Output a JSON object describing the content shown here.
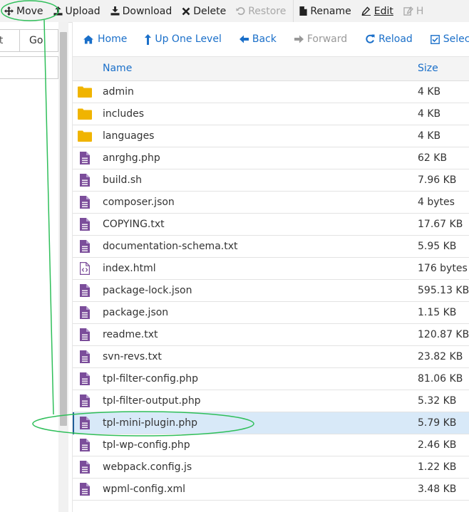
{
  "toolbar": {
    "items": [
      {
        "label": "Move",
        "icon": "move-icon"
      },
      {
        "label": "Upload",
        "icon": "upload-icon"
      },
      {
        "label": "Download",
        "icon": "download-icon"
      },
      {
        "label": "Delete",
        "icon": "delete-icon"
      },
      {
        "label": "Restore",
        "icon": "restore-icon",
        "disabled": true
      },
      {
        "label": "Rename",
        "icon": "rename-icon"
      },
      {
        "label": "Edit",
        "icon": "edit-icon"
      },
      {
        "label": "H",
        "icon": "html-editor-icon",
        "disabled": true
      }
    ]
  },
  "left": {
    "input_value": "nt",
    "go_label": "Go"
  },
  "nav": {
    "home": "Home",
    "up": "Up One Level",
    "back": "Back",
    "forward": "Forward",
    "reload": "Reload",
    "select_all": "Select All"
  },
  "table": {
    "col_name": "Name",
    "col_size": "Size",
    "rows": [
      {
        "name": "admin",
        "size": "4 KB",
        "type": "folder"
      },
      {
        "name": "includes",
        "size": "4 KB",
        "type": "folder"
      },
      {
        "name": "languages",
        "size": "4 KB",
        "type": "folder"
      },
      {
        "name": "anrghg.php",
        "size": "62 KB",
        "type": "file"
      },
      {
        "name": "build.sh",
        "size": "7.96 KB",
        "type": "file"
      },
      {
        "name": "composer.json",
        "size": "4 bytes",
        "type": "file"
      },
      {
        "name": "COPYING.txt",
        "size": "17.67 KB",
        "type": "file"
      },
      {
        "name": "documentation-schema.txt",
        "size": "5.95 KB",
        "type": "file"
      },
      {
        "name": "index.html",
        "size": "176 bytes",
        "type": "code"
      },
      {
        "name": "package-lock.json",
        "size": "595.13 KB",
        "type": "file"
      },
      {
        "name": "package.json",
        "size": "1.15 KB",
        "type": "file"
      },
      {
        "name": "readme.txt",
        "size": "120.87 KB",
        "type": "file"
      },
      {
        "name": "svn-revs.txt",
        "size": "23.82 KB",
        "type": "file"
      },
      {
        "name": "tpl-filter-config.php",
        "size": "81.06 KB",
        "type": "file"
      },
      {
        "name": "tpl-filter-output.php",
        "size": "5.32 KB",
        "type": "file"
      },
      {
        "name": "tpl-mini-plugin.php",
        "size": "5.79 KB",
        "type": "file",
        "selected": true
      },
      {
        "name": "tpl-wp-config.php",
        "size": "2.46 KB",
        "type": "file"
      },
      {
        "name": "webpack.config.js",
        "size": "1.22 KB",
        "type": "file"
      },
      {
        "name": "wpml-config.xml",
        "size": "3.48 KB",
        "type": "file"
      }
    ]
  },
  "colors": {
    "link": "#1a6fc9",
    "folder": "#f0b400",
    "file": "#7b4d9a",
    "selected_row": "#d8e9f8",
    "annotation": "#2fbf5a"
  }
}
